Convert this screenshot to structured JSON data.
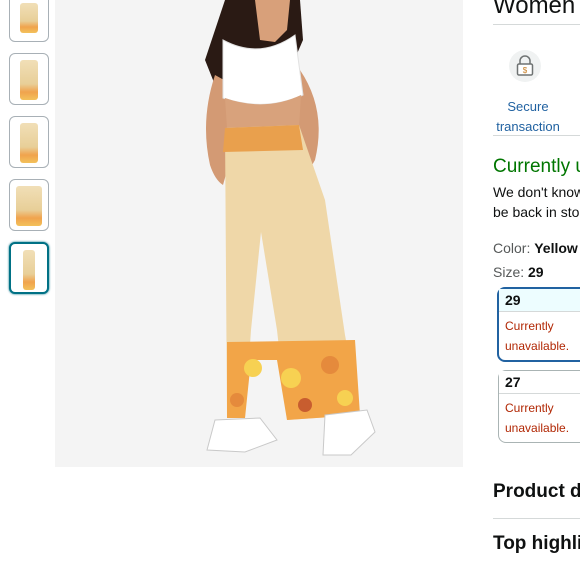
{
  "product": {
    "title": "Women"
  },
  "gallery": {
    "thumbnails": [
      {
        "name": "thumbnail-1"
      },
      {
        "name": "thumbnail-2"
      },
      {
        "name": "thumbnail-3"
      },
      {
        "name": "thumbnail-4"
      },
      {
        "name": "thumbnail-5",
        "selected": true
      }
    ]
  },
  "buy_box": {
    "secure_transaction": "Secure transaction",
    "availability": "Currently u",
    "availability_note_line1": "We don't know",
    "availability_note_line2": "be back in stoc",
    "color_label": "Color: ",
    "color_value": "Yellow",
    "size_label": "Size: ",
    "size_value": "29",
    "sizes": [
      {
        "size": "29",
        "status_line1": "Currently",
        "status_line2": "unavailable.",
        "selected": true
      },
      {
        "size": "27",
        "status_line1": "Currently",
        "status_line2": "unavailable.",
        "selected": false
      }
    ]
  },
  "sections": {
    "product_details": "Product d",
    "top_highlights": "Top highli"
  },
  "colors": {
    "link": "#2162a1",
    "availability": "#007600",
    "unavailable": "#b12704",
    "selected_border": "#2162a1"
  }
}
